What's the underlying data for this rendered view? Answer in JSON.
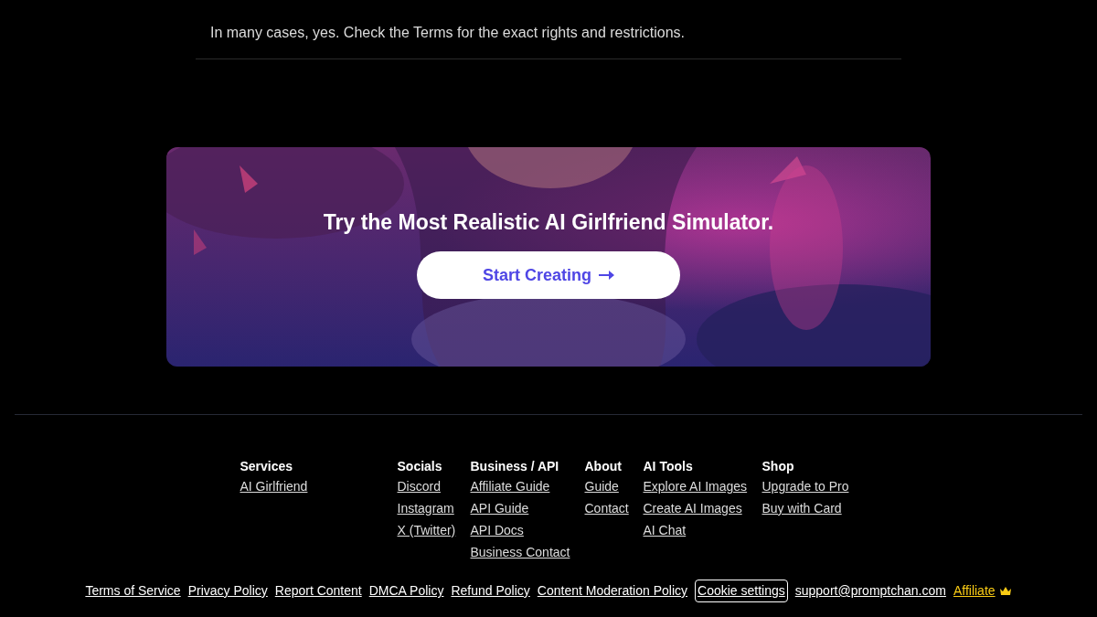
{
  "faq_answer": "In many cases, yes. Check the Terms for the exact rights and restrictions.",
  "banner": {
    "kind": "picture",
    "title": "Try the Most Realistic AI Girlfriend Simulator.",
    "button": "Start Creating"
  },
  "footer_columns": [
    {
      "heading": "Services",
      "links": [
        "AI Girlfriend"
      ]
    },
    {
      "heading": "Socials",
      "links": [
        "Discord",
        "Instagram",
        "X (Twitter)"
      ]
    },
    {
      "heading": "Business / API",
      "links": [
        "Affiliate Guide",
        "API Guide",
        "API Docs",
        "Business Contact"
      ]
    },
    {
      "heading": "About",
      "links": [
        "Guide",
        "Contact"
      ]
    },
    {
      "heading": "AI Tools",
      "links": [
        "Explore AI Images",
        "Create AI Images",
        "AI Chat"
      ]
    },
    {
      "heading": "Shop",
      "links": [
        "Upgrade to Pro",
        "Buy with Card"
      ]
    }
  ],
  "bottom_links": [
    {
      "label": "Terms of Service",
      "kind": "link"
    },
    {
      "label": "Privacy Policy",
      "kind": "link"
    },
    {
      "label": "Report Content",
      "kind": "link"
    },
    {
      "label": "DMCA Policy",
      "kind": "link"
    },
    {
      "label": "Refund Policy",
      "kind": "link"
    },
    {
      "label": "Content Moderation Policy",
      "kind": "link"
    },
    {
      "label": "Cookie settings",
      "kind": "button"
    },
    {
      "label": "support@promptchan.com",
      "kind": "link"
    },
    {
      "label": "Affiliate",
      "kind": "affiliate"
    }
  ]
}
